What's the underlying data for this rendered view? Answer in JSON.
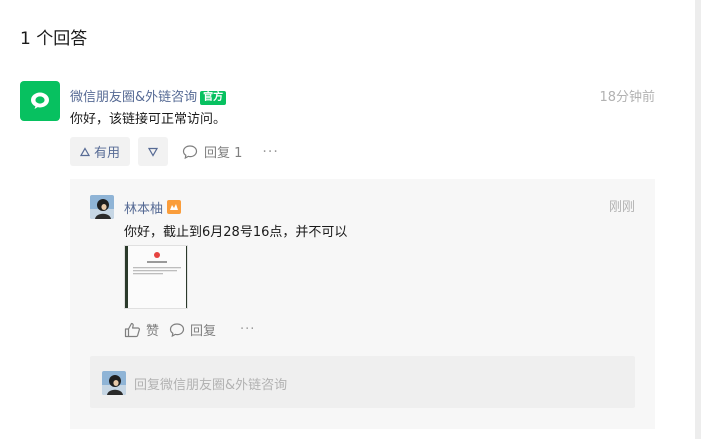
{
  "answers_header": {
    "count_label": "1 个回答"
  },
  "answer": {
    "author": "微信朋友圈&外链咨询",
    "badge": "官方",
    "time": "18分钟前",
    "content": "你好，该链接可正常访问。",
    "actions": {
      "useful_label": "有用",
      "useless_icon": "triangle-down-icon",
      "reply_label": "回复 1",
      "more_label": "···"
    }
  },
  "reply": {
    "author": "林本柚",
    "level_badge": "Lv",
    "time": "刚刚",
    "content": "你好，截止到6月28号16点，并不可以",
    "image_icon": "screenshot-thumbnail",
    "actions": {
      "like_label": "赞",
      "reply_label": "回复",
      "more_label": "···"
    }
  },
  "reply_input": {
    "placeholder": "回复微信朋友圈&外链咨询"
  },
  "colors": {
    "brand_green": "#07c160",
    "link_blue": "#576b95",
    "muted_gray": "#b2b2b2",
    "level_orange": "#fa9d3b"
  }
}
